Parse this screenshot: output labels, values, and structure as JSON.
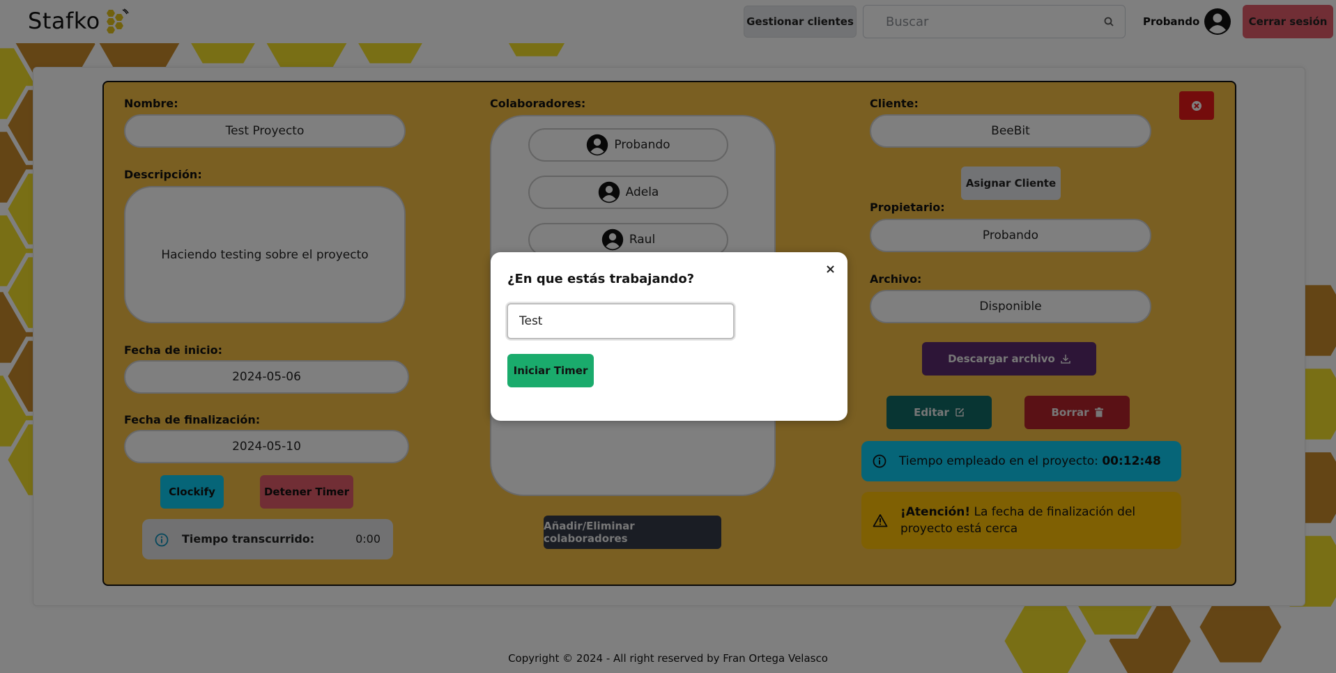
{
  "header": {
    "logo_text": "Stafko",
    "manage_clients_label": "Gestionar clientes",
    "search_placeholder": "Buscar",
    "user_name": "Probando",
    "logout_label": "Cerrar sesión"
  },
  "project": {
    "name_label": "Nombre:",
    "name_value": "Test Proyecto",
    "description_label": "Descripción:",
    "description_value": "Haciendo testing sobre el proyecto",
    "start_label": "Fecha de inicio:",
    "start_value": "2024-05-06",
    "end_label": "Fecha de finalización:",
    "end_value": "2024-05-10",
    "clockify_label": "Clockify",
    "stop_timer_label": "Detener Timer",
    "elapsed_label": "Tiempo transcurrido:",
    "elapsed_value": "0:00",
    "collaborators_label": "Colaboradores:",
    "collaborators": [
      "Probando",
      "Adela",
      "Raul"
    ],
    "edit_collaborators_label": "Añadir/Eliminar colaboradores",
    "client_label": "Cliente:",
    "client_value": "BeeBit",
    "assign_client_label": "Asignar Cliente",
    "owner_label": "Propietario:",
    "owner_value": "Probando",
    "file_label": "Archivo:",
    "file_value": "Disponible",
    "download_label": "Descargar archivo",
    "edit_label": "Editar",
    "delete_label": "Borrar",
    "time_spent_text": "Tiempo empleado en el proyecto: ",
    "time_spent_value": "00:12:48",
    "warning_strong": "¡Atención!",
    "warning_text": " La fecha de finalización del proyecto está cerca"
  },
  "modal": {
    "title": "¿En que estás trabajando?",
    "close_glyph": "×",
    "input_value": "Test",
    "start_button_label": "Iniciar Timer"
  },
  "footer": {
    "copyright": "Copyright © 2024 - All right reserved by Fran Ortega Velasco"
  },
  "colors": {
    "honey": "#f5be45",
    "dark_honey": "#c98a2b",
    "yellow": "#f2de2a",
    "info": "#0dcaf0",
    "warning": "#ffc107",
    "danger": "#dc3545",
    "success": "#1aab6c"
  }
}
